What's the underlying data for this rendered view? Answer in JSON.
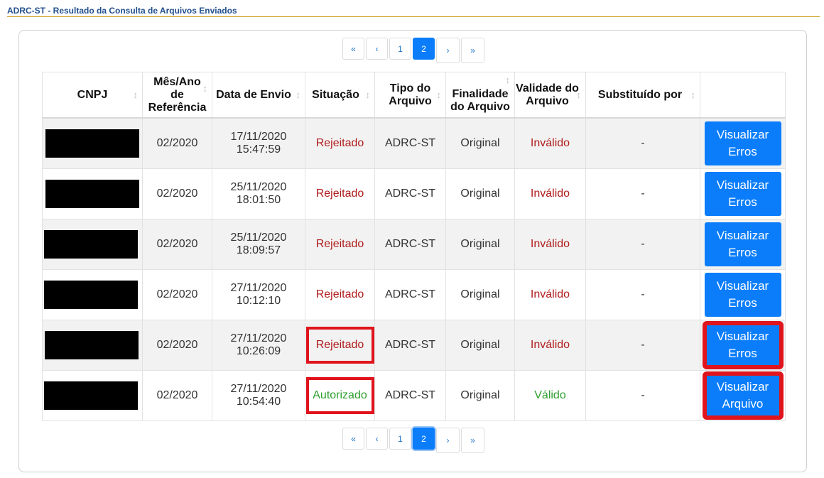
{
  "header": {
    "title": "ADRC-ST - Resultado da Consulta de Arquivos Enviados"
  },
  "pagination": {
    "first": "«",
    "prev": "‹",
    "page1": "1",
    "page2": "2",
    "next": "›",
    "last": "»",
    "current_page": "2"
  },
  "table": {
    "columns": [
      "CNPJ",
      "Mês/Ano de Referência",
      "Data de Envio",
      "Situação",
      "Tipo do Arquivo",
      "Finalidade do Arquivo",
      "Validade do Arquivo",
      "Substituído por",
      ""
    ],
    "rows": [
      {
        "cnpj": "",
        "ref": "02/2020",
        "date": "17/11/2020",
        "time": "15:47:59",
        "status": "Rejeitado",
        "tipo": "ADRC-ST",
        "finalidade": "Original",
        "validade": "Inválido",
        "substituido": "-",
        "action1": "Visualizar",
        "action2": "Erros"
      },
      {
        "cnpj": "",
        "ref": "02/2020",
        "date": "25/11/2020",
        "time": "18:01:50",
        "status": "Rejeitado",
        "tipo": "ADRC-ST",
        "finalidade": "Original",
        "validade": "Inválido",
        "substituido": "-",
        "action1": "Visualizar",
        "action2": "Erros"
      },
      {
        "cnpj": "",
        "ref": "02/2020",
        "date": "25/11/2020",
        "time": "18:09:57",
        "status": "Rejeitado",
        "tipo": "ADRC-ST",
        "finalidade": "Original",
        "validade": "Inválido",
        "substituido": "-",
        "action1": "Visualizar",
        "action2": "Erros"
      },
      {
        "cnpj": "",
        "ref": "02/2020",
        "date": "27/11/2020",
        "time": "10:12:10",
        "status": "Rejeitado",
        "tipo": "ADRC-ST",
        "finalidade": "Original",
        "validade": "Inválido",
        "substituido": "-",
        "action1": "Visualizar",
        "action2": "Erros"
      },
      {
        "cnpj": "",
        "ref": "02/2020",
        "date": "27/11/2020",
        "time": "10:26:09",
        "status": "Rejeitado",
        "tipo": "ADRC-ST",
        "finalidade": "Original",
        "validade": "Inválido",
        "substituido": "-",
        "action1": "Visualizar",
        "action2": "Erros"
      },
      {
        "cnpj": "",
        "ref": "02/2020",
        "date": "27/11/2020",
        "time": "10:54:40",
        "status": "Autorizado",
        "tipo": "ADRC-ST",
        "finalidade": "Original",
        "validade": "Válido",
        "substituido": "-",
        "action1": "Visualizar",
        "action2": "Arquivo"
      }
    ]
  },
  "colors": {
    "accent": "#0b7dfa",
    "rejected": "#b01c1c",
    "authorized": "#2e9e2e",
    "highlight": "#e0141c",
    "header_rule": "#c9a227",
    "header_text": "#1f4e8c"
  },
  "icons": {
    "sort": "sort-arrows-icon",
    "redaction": "redaction-bar"
  }
}
